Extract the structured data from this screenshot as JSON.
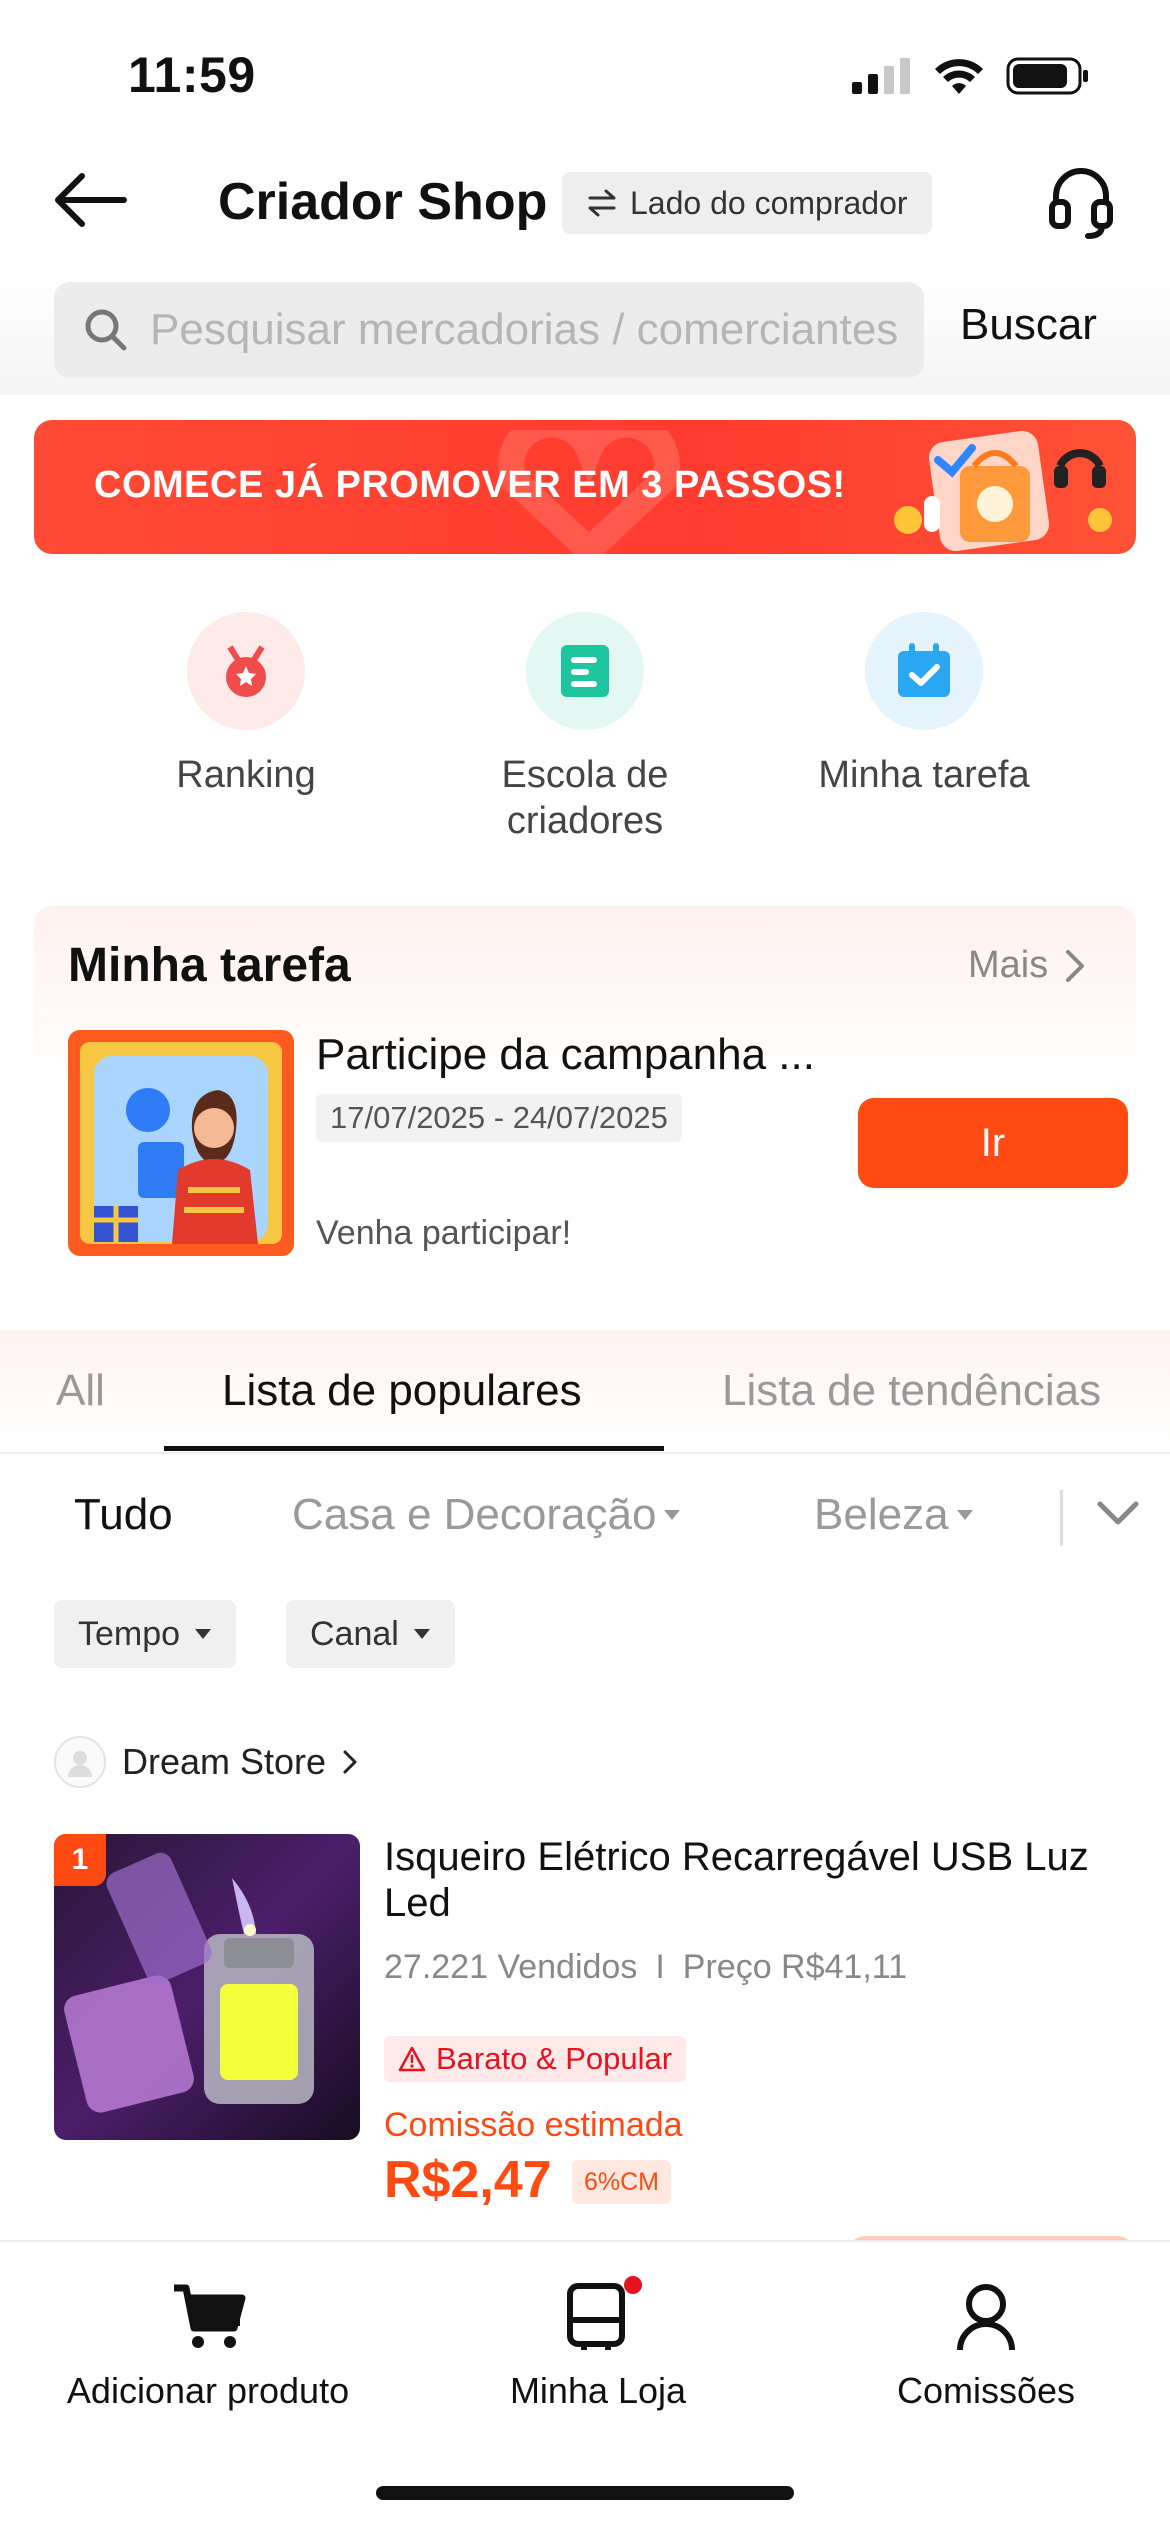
{
  "status": {
    "time": "11:59"
  },
  "header": {
    "title": "Criador Shop",
    "side_badge": "Lado do comprador"
  },
  "search": {
    "placeholder": "Pesquisar mercadorias / comerciantes",
    "button": "Buscar"
  },
  "banner": {
    "text": "COMECE JÁ PROMOVER EM 3 PASSOS!"
  },
  "quick_actions": [
    {
      "label": "Ranking",
      "icon": "medal-icon",
      "color": "#f04c4c"
    },
    {
      "label": "Escola de criadores",
      "icon": "book-icon",
      "color": "#1ec6a0"
    },
    {
      "label": "Minha tarefa",
      "icon": "calendar-check-icon",
      "color": "#2aa7f2"
    }
  ],
  "task": {
    "section_title": "Minha tarefa",
    "more": "Mais",
    "name": "Participe da campanha ...",
    "date": "17/07/2025 - 24/07/2025",
    "desc": "Venha participar!",
    "button": "Ir"
  },
  "tabs": [
    "All",
    "Lista de populares",
    "Lista de tendências"
  ],
  "categories": [
    "Tudo",
    "Casa e Decoração",
    "Beleza"
  ],
  "filters": [
    "Tempo",
    "Canal"
  ],
  "store": {
    "name": "Dream Store"
  },
  "product": {
    "rank": "1",
    "name": "Isqueiro Elétrico Recarregável USB Luz Led",
    "sold": "27.221 Vendidos",
    "separator": "I",
    "price": "Preço R$41,11",
    "tag": "Barato & Popular",
    "commission_label": "Comissão estimada",
    "commission": "R$2,47",
    "rate": "6%CM"
  },
  "bottom_nav": [
    "Adicionar produto",
    "Minha Loja",
    "Comissões"
  ],
  "colors": {
    "accent": "#ff4b12",
    "banner": "#ff3b2f",
    "badge_dot": "#e8121f"
  }
}
